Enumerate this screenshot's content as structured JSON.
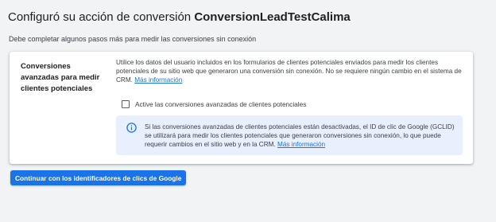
{
  "header": {
    "title_prefix": "Configuró su acción de conversión ",
    "title_name": "ConversionLeadTestCalima",
    "subtitle": "Debe completar algunos pasos más para medir las conversiones sin conexión"
  },
  "card": {
    "label": "Conversiones avanzadas para medir clientes potenciales",
    "description": "Utilice los datos del usuario incluidos en los formularios de clientes potenciales enviados para medir los clientes potenciales de su sitio web que generaron una conversión sin conexión. No se requiere ningún cambio en el sistema de CRM. ",
    "description_link": "Más información",
    "checkbox_label": "Active las conversiones avanzadas de clientes potenciales",
    "checkbox_checked": false,
    "info_text": "Si las conversiones avanzadas de clientes potenciales están desactivadas, el ID de clic de Google (GCLID) se utilizará para medir los clientes potenciales que generaron conversiones sin conexión, lo que puede requerir cambios en el sitio web y en la CRM. ",
    "info_link": "Más información",
    "info_icon": "info-icon"
  },
  "actions": {
    "continue_label": "Continuar con los identificadores de clics de Google"
  },
  "colors": {
    "primary": "#1a73e8",
    "info_background": "#e8f0fe",
    "page_background": "#f1f3f4"
  }
}
